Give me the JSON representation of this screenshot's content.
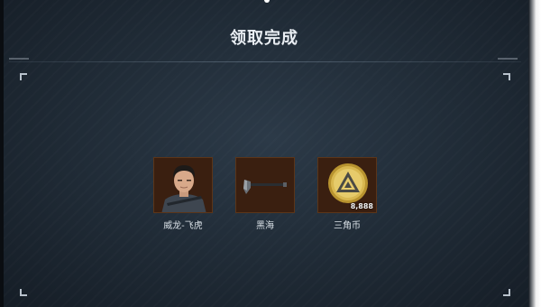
{
  "header": {
    "title": "领取完成"
  },
  "rewards": [
    {
      "label": "威龙-飞虎",
      "icon": "character-portrait-icon"
    },
    {
      "label": "黑海",
      "icon": "axe-weapon-icon"
    },
    {
      "label": "三角币",
      "icon": "triangle-coin-icon",
      "quantity": "8,888"
    }
  ],
  "colors": {
    "background": "#1f2a35",
    "card": "#3d2212",
    "coin_gold": "#d4b24a",
    "text": "#d9e0e6"
  }
}
